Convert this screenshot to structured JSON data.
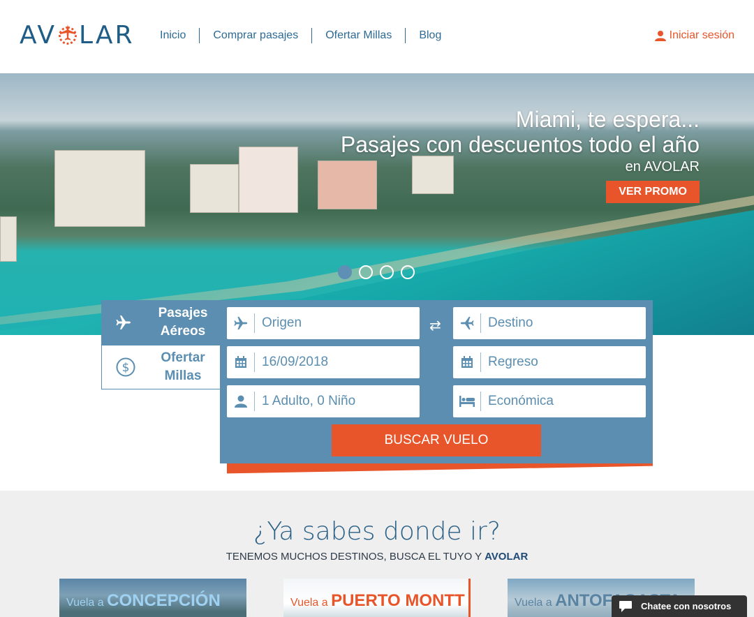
{
  "header": {
    "logo": {
      "left": "AV",
      "right": "LAR"
    },
    "nav": [
      "Inicio",
      "Comprar pasajes",
      "Ofertar Millas",
      "Blog"
    ],
    "login_label": "Iniciar sesión"
  },
  "hero": {
    "title": "Miami, te espera...",
    "subtitle": "Pasajes con descuentos todo el año",
    "brand_line": "en AVOLAR",
    "promo_button": "VER PROMO",
    "carousel": {
      "slides": 4,
      "active": 1
    }
  },
  "search": {
    "tabs": [
      {
        "label": "Pasajes Aéreos",
        "active": true
      },
      {
        "label": "Ofertar Millas",
        "active": false
      }
    ],
    "origin_placeholder": "Origen",
    "destination_placeholder": "Destino",
    "departure_date": "16/09/2018",
    "return_placeholder": "Regreso",
    "passengers": "1 Adulto, 0 Niño",
    "cabin_class": "Económica",
    "submit_label": "BUSCAR VUELO"
  },
  "destinations": {
    "title": "¿Ya sabes donde ir?",
    "subtitle_prefix": "TENEMOS MUCHOS DESTINOS, BUSCA EL TUYO Y",
    "subtitle_brand": "AVOLAR",
    "cards": [
      {
        "prefix": "Vuela a",
        "city": "CONCEPCIÓN"
      },
      {
        "prefix": "Vuela a",
        "city": "PUERTO MONTT"
      },
      {
        "prefix": "Vuela a",
        "city": "ANTOFAGASTA"
      }
    ]
  },
  "chat": {
    "label": "Chatee con nosotros"
  },
  "colors": {
    "brand_blue": "#2d6a94",
    "accent_orange": "#e8552a",
    "panel_blue": "#5b8eb0"
  },
  "icons": [
    "plane-icon",
    "dollar-icon",
    "calendar-icon",
    "user-icon",
    "bed-icon",
    "swap-icon",
    "chat-icon"
  ]
}
